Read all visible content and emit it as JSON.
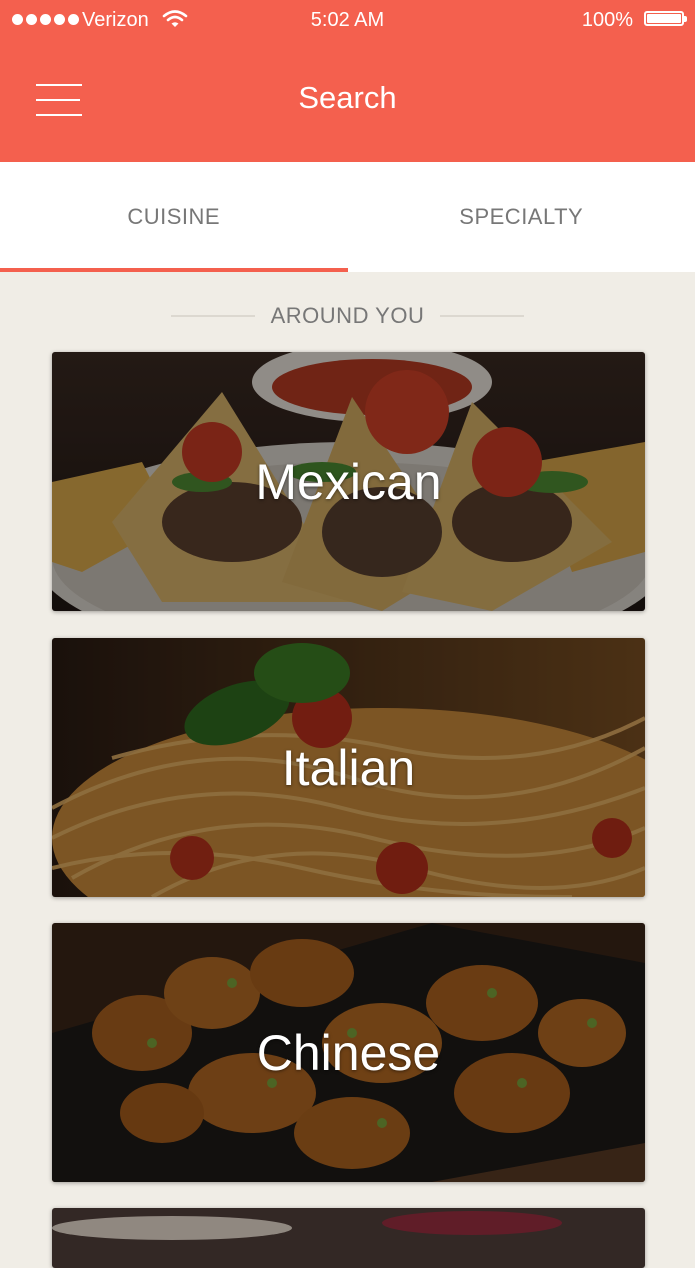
{
  "status_bar": {
    "carrier": "Verizon",
    "time": "5:02 AM",
    "battery": "100%"
  },
  "header": {
    "title": "Search"
  },
  "tabs": [
    {
      "label": "CUISINE",
      "active": true
    },
    {
      "label": "SPECIALTY",
      "active": false
    }
  ],
  "section": {
    "title": "AROUND YOU"
  },
  "cards": [
    {
      "label": "Mexican"
    },
    {
      "label": "Italian"
    },
    {
      "label": "Chinese"
    }
  ],
  "colors": {
    "accent": "#f4604e",
    "background": "#f0ede6"
  }
}
